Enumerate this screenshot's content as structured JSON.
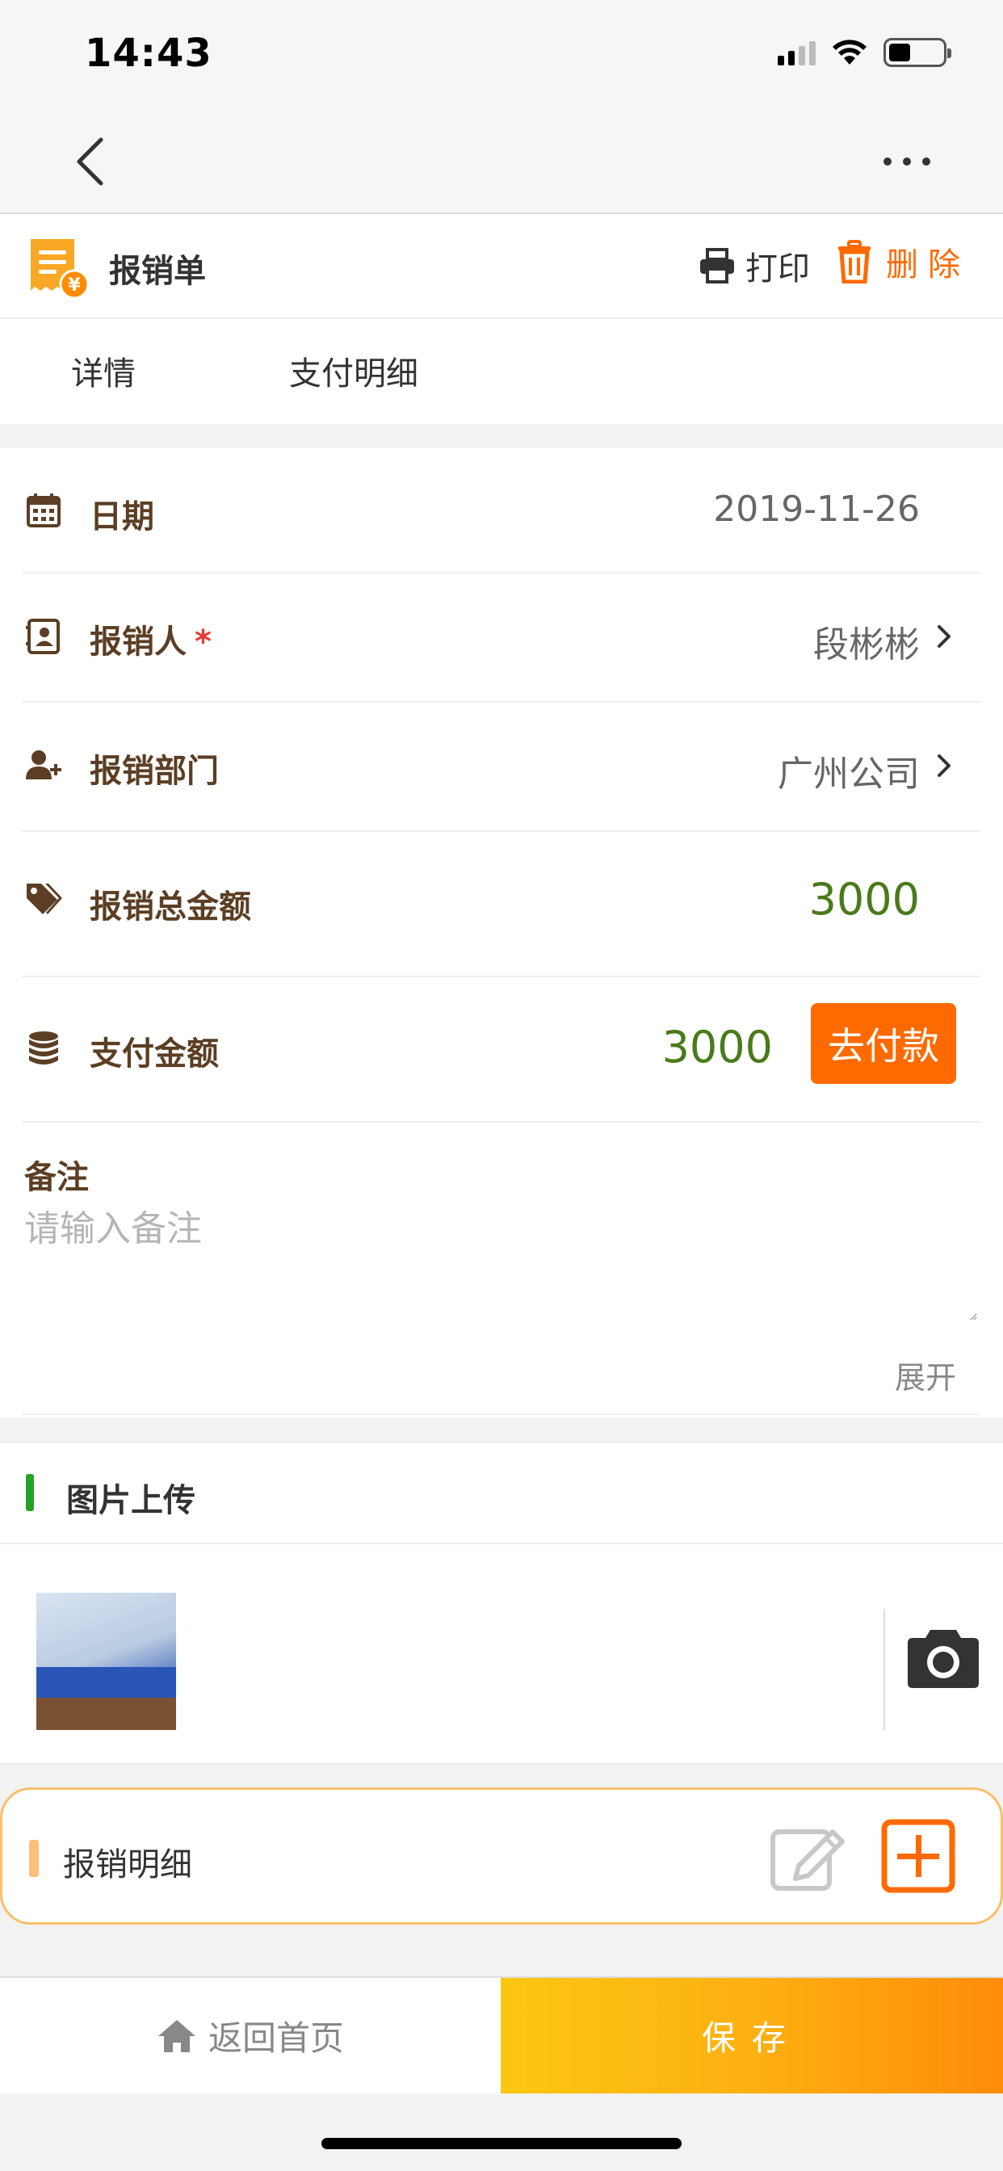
{
  "status_bar": {
    "time": "14:43"
  },
  "header": {
    "title": "报销单",
    "print_label": "打印",
    "delete_label": "删除"
  },
  "tabs": [
    {
      "label": "详情"
    },
    {
      "label": "支付明细"
    }
  ],
  "form": {
    "date": {
      "label": "日期",
      "value": "2019-11-26"
    },
    "claimant": {
      "label": "报销人",
      "required_mark": "*",
      "value": "段彬彬"
    },
    "department": {
      "label": "报销部门",
      "value": "广州公司"
    },
    "total_amount": {
      "label": "报销总金额",
      "value": "3000"
    },
    "payment_amount": {
      "label": "支付金额",
      "value": "3000",
      "button_label": "去付款"
    },
    "remark": {
      "label": "备注",
      "placeholder": "请输入备注",
      "expand_label": "展开"
    }
  },
  "upload": {
    "title": "图片上传"
  },
  "details": {
    "title": "报销明细"
  },
  "bottom_bar": {
    "home_label": "返回首页",
    "save_label": "保存"
  },
  "colors": {
    "accent_orange": "#ff6a00",
    "value_green": "#4a7a1a",
    "label_brown": "#5b3e23",
    "upload_bar_green": "#22a326"
  }
}
